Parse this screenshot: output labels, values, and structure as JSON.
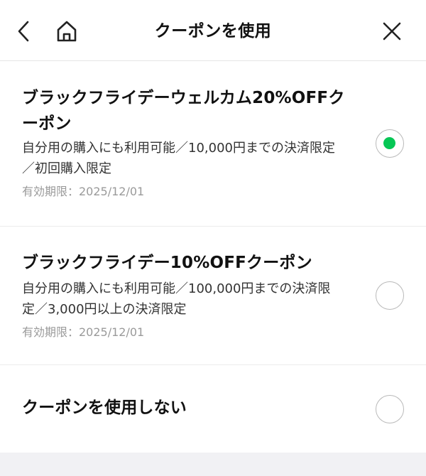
{
  "header": {
    "title": "クーポンを使用",
    "back_icon": "chevron-left-icon",
    "home_icon": "home-icon",
    "close_icon": "close-icon"
  },
  "coupons": [
    {
      "title_line1": "ブラックフライデーウェルカム20%OFFク",
      "title_line2": "ーポン",
      "desc_line1": "自分用の購入にも利用可能／10,000円までの決済限定",
      "desc_line2": "／初回購入限定",
      "expiry": "有効期限：2025/12/01",
      "selected": true
    },
    {
      "title_line1": "ブラックフライデー10%OFFクーポン",
      "desc_line1": "自分用の購入にも利用可能／100,000円までの決済限",
      "desc_line2": "定／3,000円以上の決済限定",
      "expiry": "有効期限：2025/12/01",
      "selected": false
    },
    {
      "title_line1": "クーポンを使用しない",
      "selected": false
    }
  ],
  "colors": {
    "accent": "#06c755",
    "divider": "#ececec",
    "expiry_text": "#9a9a9a",
    "footer_band": "#f1f1f4"
  }
}
